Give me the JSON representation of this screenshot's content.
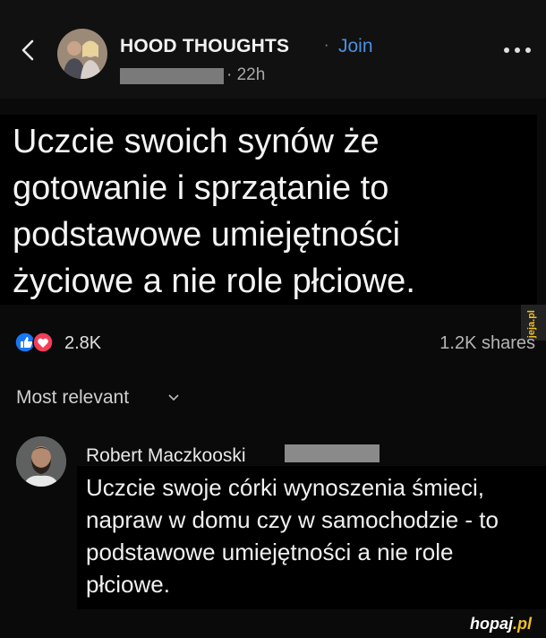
{
  "header": {
    "group_name": "HOOD THOUGHTS",
    "separator": "·",
    "join_label": "Join",
    "time": "· 22h",
    "icons": {
      "back": "chevron-left-icon",
      "more": "more-horizontal-icon"
    },
    "colors": {
      "join": "#4a90e2"
    }
  },
  "post": {
    "text": "Uczcie swoich synów że gotowanie i sprzątanie to podstawowe umiejętności życiowe a nie role płciowe."
  },
  "engagement": {
    "reaction_count": "2.8K",
    "shares": "1.2K shares",
    "icons": {
      "like": "like-icon",
      "love": "love-icon"
    }
  },
  "comments": {
    "sort_label": "Most relevant",
    "items": [
      {
        "author": "Robert Maczkooski",
        "text": "Uczcie swoje córki wynoszenia śmieci, napraw w domu czy w samochodzie - to podstawowe umiejętności a nie role płciowe."
      }
    ]
  },
  "watermarks": {
    "side": "jeja.pl",
    "bottom_main": "hopaj",
    "bottom_suffix": ".pl"
  }
}
